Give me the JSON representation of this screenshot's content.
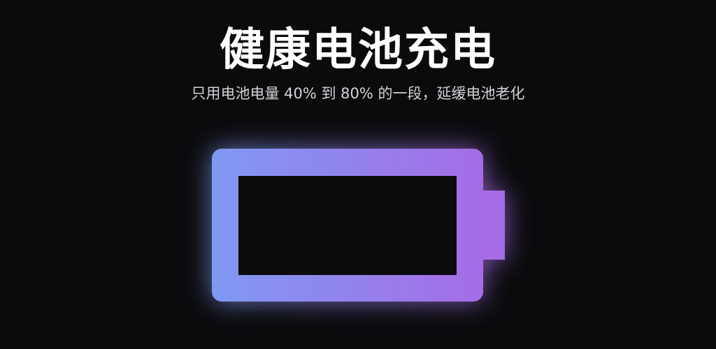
{
  "header": {
    "title": "健康电池充电",
    "subtitle": "只用电池电量 40% 到 80% 的一段，延缓电池老化"
  },
  "battery": {
    "icon": "battery-icon",
    "gradient_start": "#7f9af2",
    "gradient_end": "#a66ce6",
    "inner_color": "#0b0b0d"
  }
}
